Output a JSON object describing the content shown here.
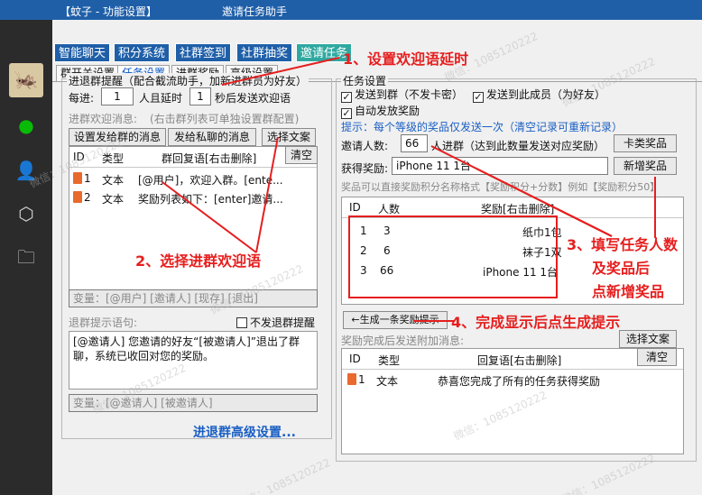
{
  "window": {
    "title_left": "【蚊子 - 功能设置】",
    "title_center": "邀请任务助手"
  },
  "top_tabs": [
    "智能聊天",
    "积分系统",
    "社群签到",
    "社群抽奖",
    "邀请任务"
  ],
  "sub_tabs": [
    "群开关设置",
    "任务设置",
    "进群奖励",
    "高级设置"
  ],
  "left": {
    "group_title": "进退群提醒（配合截流助手，加新进群员为好友）",
    "every_prefix": "每进:",
    "every_value": "1",
    "delay_mid": "人且延时",
    "delay_value": "1",
    "delay_suffix": "秒后发送欢迎语",
    "welcome_label": "进群欢迎消息:",
    "welcome_hint": "(右击群列表可单独设置群配置)",
    "btn_group_msg": "设置发给群的消息",
    "btn_private_msg": "发给私聊的消息",
    "btn_choose": "选择文案",
    "btn_clear": "清空",
    "table_headers": [
      "ID",
      "类型",
      "群回复语[右击删除]"
    ],
    "table_rows": [
      {
        "id": "1",
        "type": "文本",
        "text": "[@用户]，欢迎入群。[ente..."
      },
      {
        "id": "2",
        "type": "文本",
        "text": "奖励列表如下：[enter]邀请..."
      }
    ],
    "variables": "变量：[@用户] [邀请人] [现存] [退出]",
    "leave_label": "退群提示语句:",
    "leave_checkbox": "不发退群提醒",
    "leave_text": "[@邀请人] 您邀请的好友“[被邀请人]”退出了群聊，系统已收回对您的奖励。",
    "leave_variables": "变量：[@邀请人] [被邀请人]",
    "advanced_link": "进退群高级设置..."
  },
  "right": {
    "group_title": "任务设置",
    "chk_send_group": "发送到群（不发卡密）",
    "chk_send_member": "发送到此成员（为好友）",
    "chk_auto_reward": "自动发放奖励",
    "hint": "提示：每个等级的奖品仅发送一次（清空记录可重新记录）",
    "invite_label": "邀请人数:",
    "invite_value": "66",
    "invite_suffix": "人进群（达到此数量发送对应奖励）",
    "btn_card": "卡类奖品",
    "reward_label": "获得奖励:",
    "reward_value": "iPhone 11 1台",
    "btn_add": "新增奖品",
    "format_hint": "奖品可以直接奖励积分名称格式【奖励积分+分数】例如【奖励积分50】",
    "table_headers": [
      "ID",
      "人数",
      "奖励[右击删除]"
    ],
    "table_rows": [
      {
        "id": "1",
        "count": "3",
        "reward": "纸巾1包"
      },
      {
        "id": "2",
        "count": "6",
        "reward": "袜子1双"
      },
      {
        "id": "3",
        "count": "66",
        "reward": "iPhone 11 1台"
      }
    ],
    "btn_generate": "←生成一条奖励提示",
    "after_label": "奖励完成后发送附加消息:",
    "btn_choose": "选择文案",
    "btn_clear": "清空",
    "after_headers": [
      "ID",
      "类型",
      "回复语[右击删除]"
    ],
    "after_rows": [
      {
        "id": "1",
        "type": "文本",
        "text": "恭喜您完成了所有的任务获得奖励"
      }
    ]
  },
  "annotations": {
    "a1": "1、设置欢迎语延时",
    "a2": "2、选择进群欢迎语",
    "a3_l1": "3、填写任务人数",
    "a3_l2": "及奖品后",
    "a3_l3": "点新增奖品",
    "a4": "4、完成显示后点生成提示"
  },
  "watermark": "微信：1085120222",
  "colors": {
    "title_blue": "#1f5fa8",
    "active_tab": "#2fa9a0",
    "annotation_red": "#e61e1e",
    "link_blue": "#1a5fc4"
  }
}
